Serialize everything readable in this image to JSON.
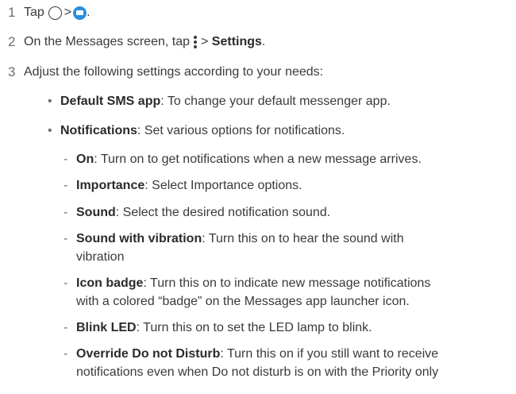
{
  "steps": [
    {
      "num": "1",
      "text": "Tap",
      "sep": ">",
      "end": "."
    },
    {
      "num": "2",
      "text_before": "On the Messages screen, tap",
      "sep": ">",
      "bold": "Settings",
      "end": "."
    },
    {
      "num": "3",
      "text": "Adjust the following settings according to your needs:"
    }
  ],
  "bullets": [
    {
      "mark": "•",
      "term": "Default SMS app",
      "desc": ": To change your default messenger app."
    },
    {
      "mark": "•",
      "term": "Notifications",
      "desc": ": Set various options for notifications."
    }
  ],
  "sub_items": [
    {
      "mark": "-",
      "term": "On",
      "desc": ": Turn on to get notifications when a new message arrives."
    },
    {
      "mark": "-",
      "term": "Importance",
      "desc": ": Select Importance options."
    },
    {
      "mark": "-",
      "term": "Sound",
      "desc": ": Select the desired notification sound."
    },
    {
      "mark": "-",
      "term": "Sound with vibration",
      "desc": ": Turn this on to hear the sound with",
      "cont": "vibration"
    },
    {
      "mark": "-",
      "term": "Icon badge",
      "desc": ": Turn this on to indicate new message notifications",
      "cont": "with a colored “badge” on the Messages app launcher icon."
    },
    {
      "mark": "-",
      "term": "Blink LED",
      "desc": ": Turn this on to set the LED lamp to blink."
    },
    {
      "mark": "-",
      "term": "Override Do not Disturb",
      "desc": ": Turn this on if you still want to receive",
      "cont": "notifications even when Do not disturb is on with the Priority only"
    }
  ],
  "icons": {
    "home": "home-circle-icon",
    "messages": "messages-app-icon",
    "more": "more-options-icon"
  },
  "colors": {
    "messages_icon": "#2a8de0"
  }
}
